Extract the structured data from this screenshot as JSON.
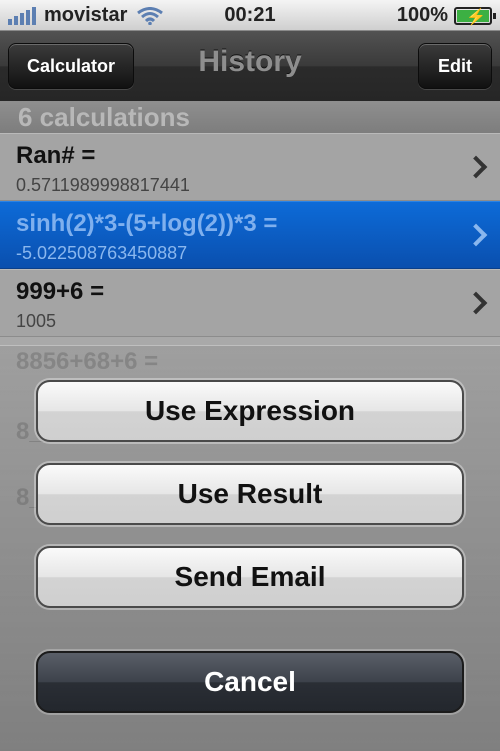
{
  "status_bar": {
    "carrier": "movistar",
    "time": "00:21",
    "battery": "100%"
  },
  "nav": {
    "left_button": "Calculator",
    "title": "History",
    "right_button": "Edit"
  },
  "section": {
    "header": "6 calculations"
  },
  "history": [
    {
      "expression": "Ran# =",
      "result": "0.5711989998817441"
    },
    {
      "expression": "sinh(2)*3-(5+log(2))*3 =",
      "result": "-5.022508763450887",
      "selected": true
    },
    {
      "expression": "999+6 =",
      "result": "1005"
    }
  ],
  "ghost_rows": [
    "8856+68+6 =",
    "8_5+3+6 =",
    "8_5 ="
  ],
  "action_sheet": {
    "use_expression": "Use Expression",
    "use_result": "Use Result",
    "send_email": "Send Email",
    "cancel": "Cancel"
  }
}
